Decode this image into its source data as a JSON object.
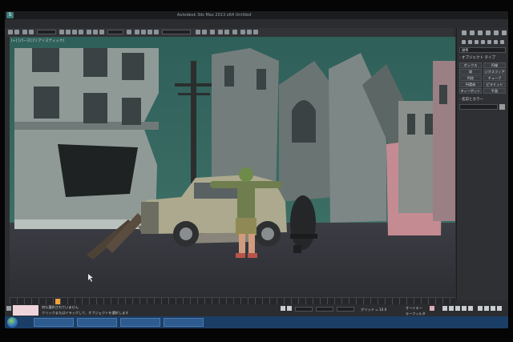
{
  "app": {
    "logo_glyph": "S",
    "title": "Autodesk 3ds Max 2013 x64   Untitled",
    "accent_color": "#3a7a79"
  },
  "menu": {
    "items": [
      "編集(E)",
      "ツール(T)",
      "グループ(G)",
      "ビュー(V)",
      "作成(C)",
      "モディファイヤ(O)",
      "アニメーション",
      "グラフエディタ",
      "レンダリング(R)",
      "カスタマイズ(U)",
      "MAXScript(M)",
      "ヘルプ(H)"
    ]
  },
  "viewport": {
    "label": "[+] [パース] [リアリスティック]"
  },
  "command_panel": {
    "search_text": "標準",
    "rollout_object_type": "- オブジェクト タイプ",
    "buttons": [
      "ボックス",
      "円錐",
      "球",
      "ジオスフィア",
      "円柱",
      "チューブ",
      "円環体",
      "ピラミッド",
      "ティーポット",
      "平面"
    ],
    "rollout_name_color": "- 名前とカラー"
  },
  "timeslider": {
    "frame_label": "0 / 100"
  },
  "status": {
    "line1": "何も選択されていません",
    "line2": "クリックまたはドラッグして、オブジェクトを選択します",
    "grid_label": "グリッド = 10.0",
    "autokey_label": "オートキー",
    "setkey_label": "キーフィルタ"
  },
  "taskbar": {
    "items": [
      "",
      "",
      "",
      ""
    ],
    "clock": "",
    "colors": {
      "bar": "#1b3e67",
      "item": "#2e5b8f"
    }
  }
}
